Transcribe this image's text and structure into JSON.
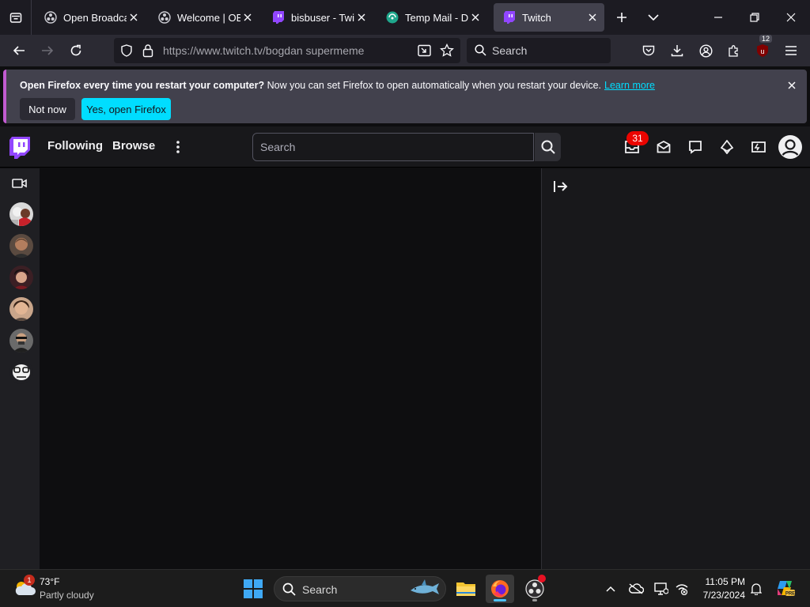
{
  "browser": {
    "tabs": [
      {
        "title": "Open Broadcast",
        "icon": "obs-icon",
        "active": false
      },
      {
        "title": "Welcome | OBS",
        "icon": "obs-icon",
        "active": false
      },
      {
        "title": "bisbuser - Twitch",
        "icon": "twitch-icon",
        "active": false
      },
      {
        "title": "Temp Mail - Disposable",
        "icon": "tempmail-icon",
        "active": false
      },
      {
        "title": "Twitch",
        "icon": "twitch-icon",
        "active": true
      }
    ],
    "url": "https://www.twitch.tv/bogdan supermeme",
    "search_placeholder": "Search",
    "extension_badge": "12"
  },
  "notification": {
    "bold_text": "Open Firefox every time you restart your computer?",
    "text": " Now you can set Firefox to open automatically when you restart your device.",
    "link": "Learn more",
    "not_now": "Not now",
    "yes": "Yes, open Firefox"
  },
  "twitch": {
    "nav": {
      "following": "Following",
      "browse": "Browse"
    },
    "search_placeholder": "Search",
    "inbox_badge": "31",
    "brand_color": "#9146ff"
  },
  "taskbar": {
    "weather": {
      "temp": "73°F",
      "condition": "Partly cloudy",
      "badge": "1"
    },
    "search_placeholder": "Search",
    "time": "11:05 PM",
    "date": "7/23/2024"
  }
}
